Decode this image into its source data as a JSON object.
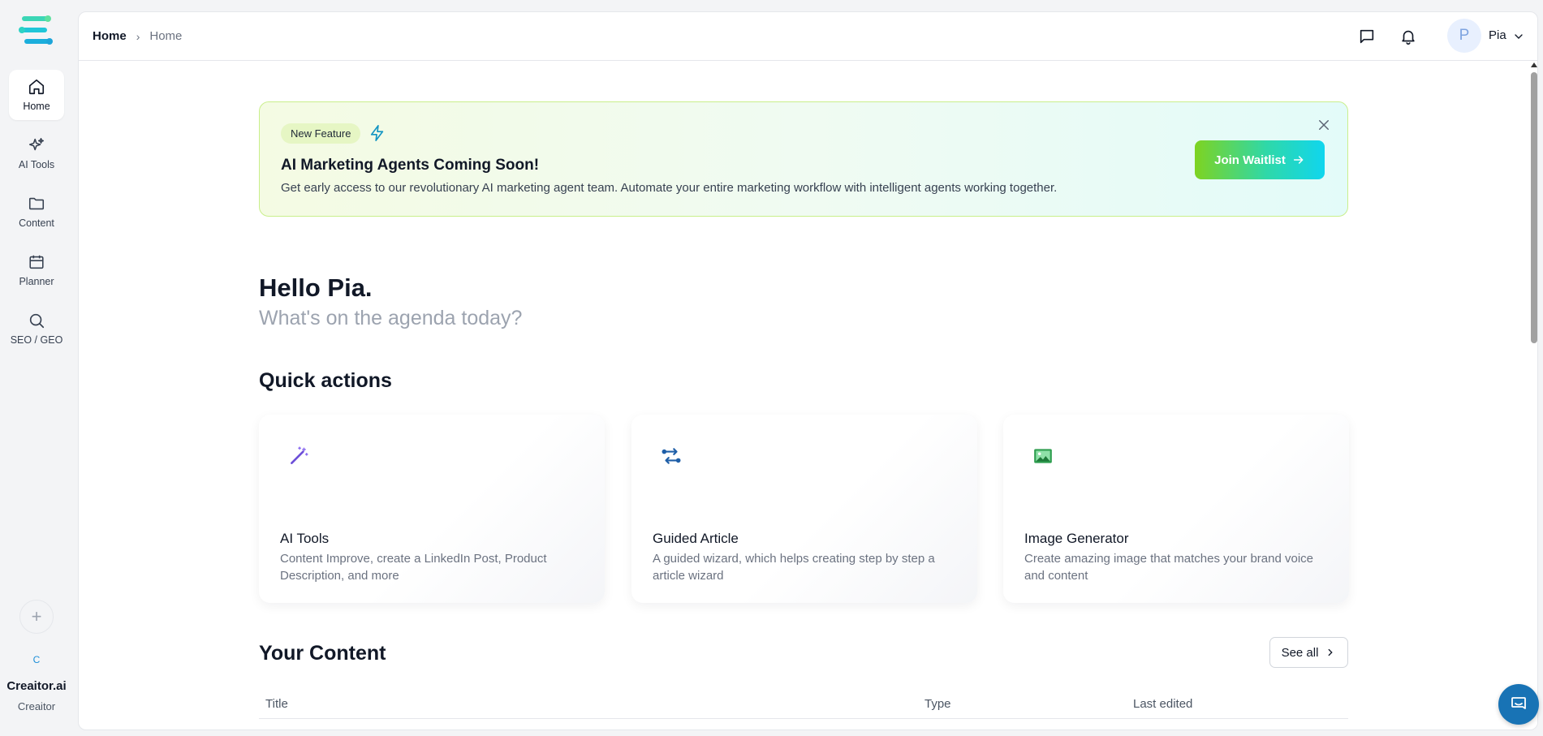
{
  "sidebar": {
    "items": [
      {
        "label": "Home",
        "icon": "home-icon",
        "active": true
      },
      {
        "label": "AI Tools",
        "icon": "sparkles-icon"
      },
      {
        "label": "Content",
        "icon": "folder-icon"
      },
      {
        "label": "Planner",
        "icon": "calendar-icon"
      },
      {
        "label": "SEO / GEO",
        "icon": "search-icon"
      }
    ],
    "add_icon": "+",
    "workspace": {
      "initial": "C",
      "name": "Creaitor.ai",
      "sub": "Creaitor"
    }
  },
  "header": {
    "breadcrumb": {
      "root": "Home",
      "current": "Home"
    },
    "user": {
      "initial": "P",
      "name": "Pia"
    }
  },
  "banner": {
    "badge": "New Feature",
    "title": "AI Marketing Agents Coming Soon!",
    "text": "Get early access to our revolutionary AI marketing agent team. Automate your entire marketing workflow with intelligent agents working together.",
    "cta": "Join Waitlist"
  },
  "greeting": {
    "title": "Hello Pia.",
    "subtitle": "What's on the agenda today?"
  },
  "quick_actions": {
    "title": "Quick actions",
    "cards": [
      {
        "title": "AI Tools",
        "description": "Content Improve, create a LinkedIn Post, Product Description, and more",
        "icon": "magic-wand-icon"
      },
      {
        "title": "Guided Article",
        "description": "A guided wizard, which helps creating step by step a article wizard",
        "icon": "route-icon"
      },
      {
        "title": "Image Generator",
        "description": "Create amazing image that matches your brand voice and content",
        "icon": "image-icon"
      }
    ]
  },
  "content": {
    "title": "Your Content",
    "see_all": "See all",
    "columns": [
      "Title",
      "Type",
      "Last edited"
    ]
  },
  "colors": {
    "accent_green": "#7ed321",
    "accent_cyan": "#10d6ee",
    "chat_button": "#1873b5"
  }
}
